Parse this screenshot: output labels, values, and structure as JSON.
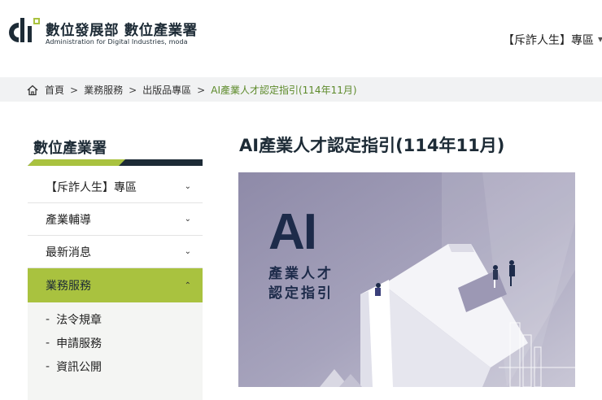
{
  "header": {
    "org_title": "數位發展部 數位產業署",
    "org_subtitle": "Administration for Digital Industries, moda",
    "right_link": "【斥詐人生】專區"
  },
  "breadcrumb": {
    "items": [
      "首頁",
      "業務服務",
      "出版品專區",
      "AI產業人才認定指引(114年11月)"
    ]
  },
  "sidebar": {
    "title": "數位產業署",
    "items": [
      {
        "label": "【斥詐人生】專區",
        "expanded": false
      },
      {
        "label": "產業輔導",
        "expanded": false
      },
      {
        "label": "最新消息",
        "expanded": false
      },
      {
        "label": "業務服務",
        "expanded": true
      }
    ],
    "subitems": [
      "法令規章",
      "申請服務",
      "資訊公開"
    ]
  },
  "main": {
    "title": "AI產業人才認定指引(114年11月)",
    "hero": {
      "big_text": "AI",
      "line1": "產業人才",
      "line2": "認定指引"
    }
  },
  "colors": {
    "accent_green": "#a9c23f",
    "dark_navy": "#1d2b36",
    "breadcrumb_current": "#5d8a2a",
    "hero_bg": "#9c98b4"
  }
}
